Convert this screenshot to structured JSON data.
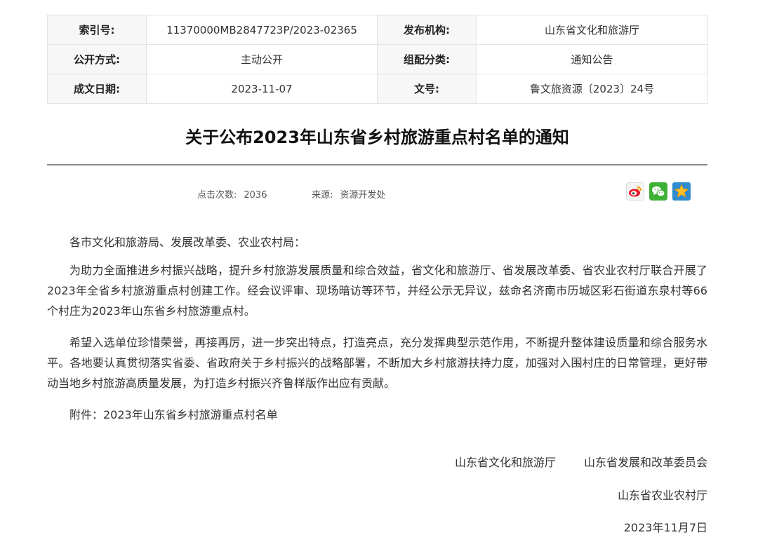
{
  "meta": {
    "index_label": "索引号:",
    "index_value": "11370000MB2847723P/2023-02365",
    "publisher_label": "发布机构:",
    "publisher_value": "山东省文化和旅游厅",
    "open_label": "公开方式:",
    "open_value": "主动公开",
    "category_label": "组配分类:",
    "category_value": "通知公告",
    "date_label": "成文日期:",
    "date_value": "2023-11-07",
    "docno_label": "文号:",
    "docno_value": "鲁文旅资源〔2023〕24号"
  },
  "article": {
    "title": "关于公布2023年山东省乡村旅游重点村名单的通知",
    "hits_label": "点击次数:",
    "hits_value": "2036",
    "source_label": "来源:",
    "source_value": "资源开发处"
  },
  "share": {
    "weibo_color": "#e6162d",
    "wechat_color": "#3eb135",
    "qzone_color": "#ffc028"
  },
  "body": {
    "greeting": "各市文化和旅游局、发展改革委、农业农村局：",
    "para1": "为助力全面推进乡村振兴战略，提升乡村旅游发展质量和综合效益，省文化和旅游厅、省发展改革委、省农业农村厅联合开展了2023年全省乡村旅游重点村创建工作。经会议评审、现场暗访等环节，并经公示无异议，兹命名济南市历城区彩石街道东泉村等66个村庄为2023年山东省乡村旅游重点村。",
    "para2": "希望入选单位珍惜荣誉，再接再厉，进一步突出特点，打造亮点，充分发挥典型示范作用，不断提升整体建设质量和综合服务水平。各地要认真贯彻落实省委、省政府关于乡村振兴的战略部署，不断加大乡村旅游扶持力度，加强对入围村庄的日常管理，更好带动当地乡村旅游高质量发展，为打造乡村振兴齐鲁样版作出应有贡献。",
    "attachment": "附件：2023年山东省乡村旅游重点村名单"
  },
  "signature": {
    "org1": "山东省文化和旅游厅",
    "org2": "山东省发展和改革委员会",
    "org3": "山东省农业农村厅",
    "date": "2023年11月7日"
  }
}
